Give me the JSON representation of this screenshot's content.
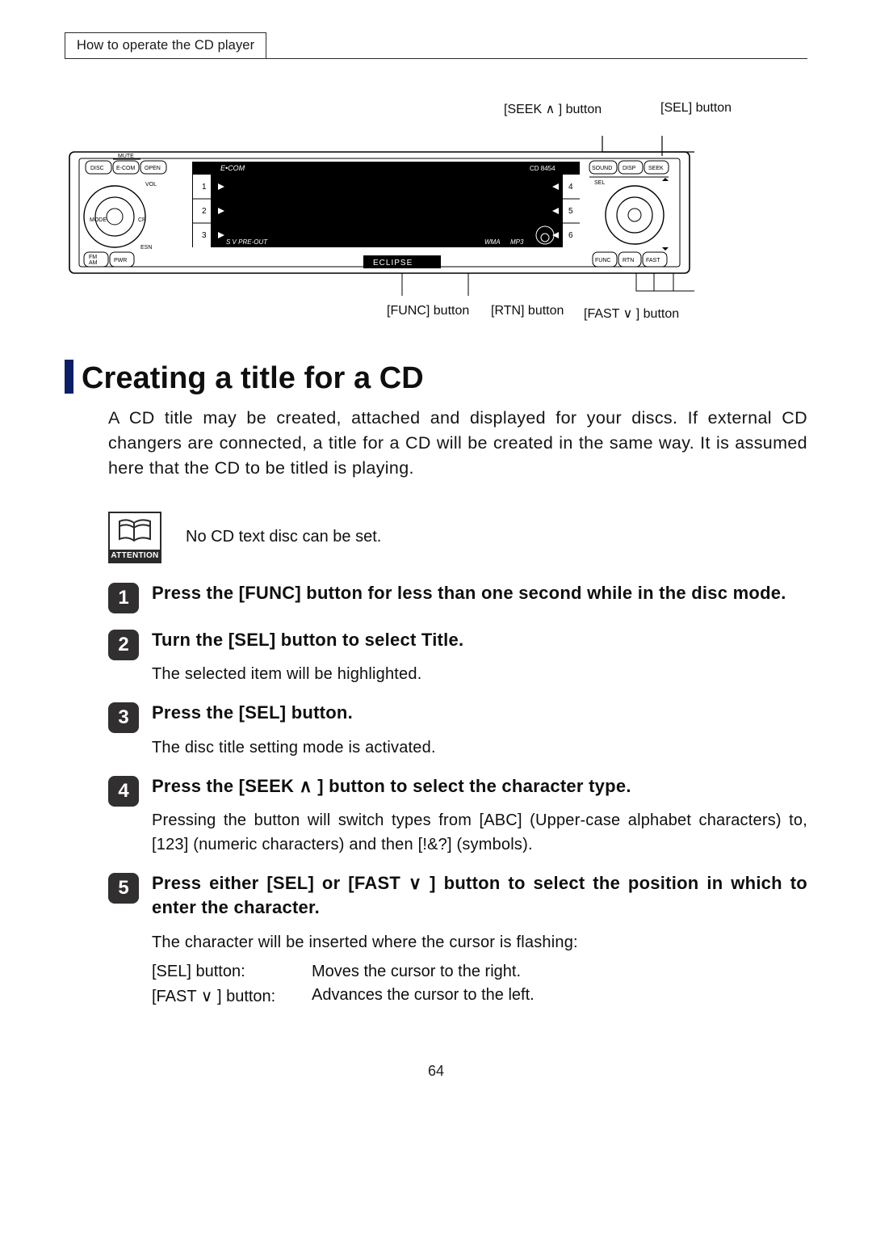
{
  "header": {
    "breadcrumb": "How to operate the CD player"
  },
  "diagram": {
    "top_labels": {
      "seek": "[SEEK ∧ ] button",
      "sel": "[SEL] button"
    },
    "bottom_labels": {
      "func": "[FUNC] button",
      "rtn": "[RTN] button",
      "fast": "[FAST ∨ ] button"
    },
    "device_text": {
      "mute": "MUTE",
      "disc": "DISC",
      "ecom": "E-COM",
      "open": "OPEN",
      "vol": "VOL",
      "mode": "MODE",
      "cr": "CR",
      "esn": "ESN",
      "fm": "FM",
      "am": "AM",
      "pwr": "PWR",
      "ecom_logo": "E•COM",
      "model": "CD 8454",
      "sound": "SOUND",
      "disp": "DISP",
      "seek": "SEEK",
      "sel": "SEL",
      "func": "FUNC",
      "rtn": "RTN",
      "fast": "FAST",
      "sv": "S V PRE-OUT",
      "wma": "WMA",
      "mp3": "MP3",
      "brand": "ECLIPSE",
      "nums_left": [
        "1",
        "2",
        "3"
      ],
      "nums_right": [
        "4",
        "5",
        "6"
      ]
    }
  },
  "heading": "Creating a title for a CD",
  "intro": "A CD title may be created, attached and displayed for your discs. If external CD changers are connected, a title for a CD will be created in the same way. It is assumed here that the CD to be titled is playing.",
  "attention": {
    "label": "ATTENTION",
    "text": "No CD text disc can be set."
  },
  "steps": [
    {
      "n": "1",
      "title": "Press the [FUNC] button for less than one second while in the disc mode."
    },
    {
      "n": "2",
      "title": "Turn the [SEL] button to select Title.",
      "note": "The selected item will be highlighted."
    },
    {
      "n": "3",
      "title": "Press the [SEL] button.",
      "note": "The disc title setting mode is activated."
    },
    {
      "n": "4",
      "title": "Press the [SEEK ∧ ] button to select the character type.",
      "note": "Pressing the button will switch types from [ABC] (Upper-case alphabet characters) to, [123] (numeric characters) and then [!&?] (symbols)."
    },
    {
      "n": "5",
      "title": "Press either [SEL] or [FAST ∨ ] button to select the position in which to enter the character.",
      "note": "The character will be inserted where the cursor is flashing:",
      "table": [
        [
          "[SEL] button:",
          "Moves the cursor to the right."
        ],
        [
          "[FAST ∨ ] button:",
          "Advances the cursor to the left."
        ]
      ]
    }
  ],
  "page_number": "64"
}
